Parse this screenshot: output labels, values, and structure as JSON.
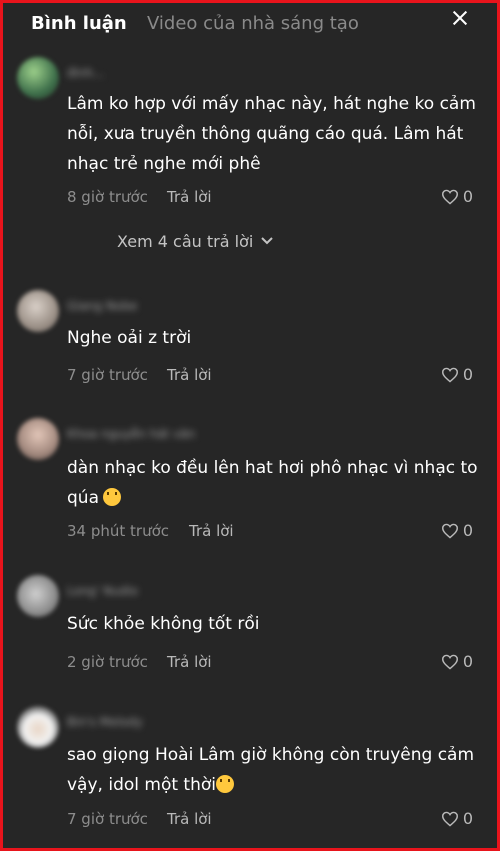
{
  "tabs": {
    "comments": "Bình luận",
    "creator_videos": "Video của nhà sáng tạo"
  },
  "close_icon": "close-icon",
  "comments": [
    {
      "username": "đinh...",
      "text": "Lâm ko hợp với mấy nhạc này, hát nghe ko cảm nỗi, xưa truyền thông quãng cáo quá. Lâm hát nhạc trẻ nghe mới phê",
      "time": "8 giờ trước",
      "reply": "Trả lời",
      "likes": "0",
      "view_replies": "Xem 4 câu trả lời"
    },
    {
      "username": "Giang Nobe",
      "text": "Nghe oải z trời",
      "time": "7 giờ trước",
      "reply": "Trả lời",
      "likes": "0"
    },
    {
      "username": "Khoa nguyễn hát văn",
      "text": "dàn nhạc ko đều lên hat hơi phô nhạc vì nhạc to qúa",
      "time": "34 phút trước",
      "reply": "Trả lời",
      "likes": "0",
      "emoji": "smiling-face-with-hearts"
    },
    {
      "username": "Long' Nudio",
      "text": "Sức khỏe không tốt rồi",
      "time": "2 giờ trước",
      "reply": "Trả lời",
      "likes": "0"
    },
    {
      "username": "Bin's Melody",
      "text": "sao giọng Hoài Lâm giờ không còn truyêng cảm vậy, idol một thời",
      "time": "7 giờ trước",
      "reply": "Trả lời",
      "likes": "0",
      "emoji": "sad-face"
    }
  ],
  "colors": {
    "background": "#262626",
    "border": "#e8141c",
    "text": "#ffffff",
    "muted": "#8d8d8d"
  }
}
